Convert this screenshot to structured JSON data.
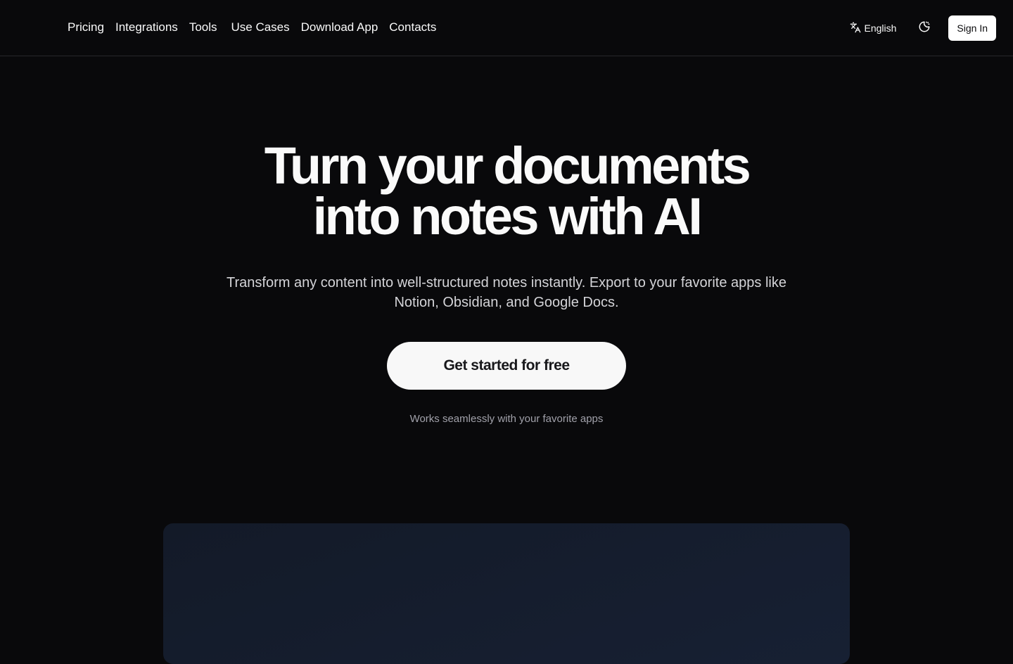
{
  "header": {
    "nav": [
      {
        "label": "Pricing"
      },
      {
        "label": "Integrations"
      },
      {
        "label": "Tools"
      },
      {
        "label": "Use Cases"
      },
      {
        "label": "Download App"
      },
      {
        "label": "Contacts"
      }
    ],
    "language": "English",
    "theme_icon": "theme-toggle-icon",
    "language_icon": "translate-icon",
    "sign_in": "Sign In"
  },
  "hero": {
    "title_line1": "Turn your documents",
    "title_line2": "into notes with AI",
    "subtitle": "Transform any content into well-structured notes instantly. Export to your favorite apps like Notion, Obsidian, and Google Docs.",
    "cta": "Get started for free",
    "works_with": "Works seamlessly with your favorite apps"
  },
  "colors": {
    "background": "#09090b",
    "text": "#fafafa",
    "muted": "#a1a1aa",
    "card": "#151d2d"
  }
}
